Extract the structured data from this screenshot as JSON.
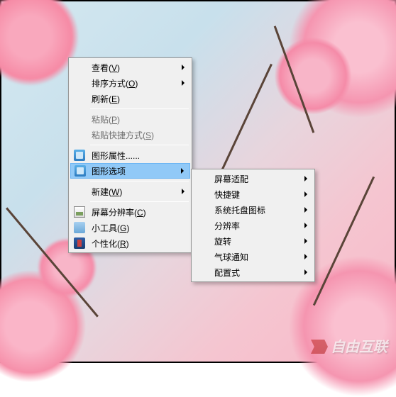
{
  "watermark": "自由互联",
  "main_menu": {
    "view": {
      "label": "查看(",
      "key": "V",
      "tail": ")"
    },
    "sort": {
      "label": "排序方式(",
      "key": "O",
      "tail": ")"
    },
    "refresh": {
      "label": "刷新(",
      "key": "E",
      "tail": ")"
    },
    "paste": {
      "label": "粘贴(",
      "key": "P",
      "tail": ")"
    },
    "paste_shortcut": {
      "label": "粘贴快捷方式(",
      "key": "S",
      "tail": ")"
    },
    "gfx_props": {
      "label": "图形属性......"
    },
    "gfx_options": {
      "label": "图形选项"
    },
    "new": {
      "label": "新建(",
      "key": "W",
      "tail": ")"
    },
    "resolution": {
      "label": "屏幕分辨率(",
      "key": "C",
      "tail": ")"
    },
    "gadgets": {
      "label": "小工具(",
      "key": "G",
      "tail": ")"
    },
    "personalize": {
      "label": "个性化(",
      "key": "R",
      "tail": ")"
    }
  },
  "sub_menu": {
    "fit": "屏幕适配",
    "hotkey": "快捷键",
    "tray": "系统托盘图标",
    "res": "分辨率",
    "rotate": "旋转",
    "balloon": "气球通知",
    "profile": "配置式"
  }
}
